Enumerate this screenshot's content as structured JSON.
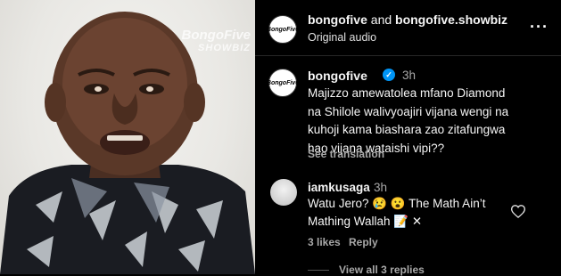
{
  "media": {
    "watermark_top": "BongoFive",
    "watermark_bottom": "SHOWBIZ"
  },
  "header": {
    "account_1": "bongofive",
    "and_text": " and ",
    "account_2": "bongofive.showbiz",
    "subtitle": "Original audio",
    "more_icon": "more-dots-icon",
    "logo_text": "BongoFive"
  },
  "caption": {
    "username": "bongofive",
    "time": "3h",
    "text": "Majizzo amewatolea mfano Diamond\nna Shilole walivyoajiri vijana wengi na\nkuhoji kama biashara zao zitafungwa\nhao vijana wataishi vipi??",
    "see_translation": "See translation",
    "logo_text": "BongoFive"
  },
  "reply": {
    "username": "iamkusaga",
    "time": "3h",
    "text": "Watu Jero? 😢 😮  The Math Ain’t Mathing Wallah 📝 ✕",
    "likes": "3 likes",
    "reply_label": "Reply",
    "view_all": "View all 3 replies",
    "like_icon": "heart-outline-icon"
  },
  "colors": {
    "background": "#000000",
    "secondary_text": "#a8a8a8",
    "verified_blue": "#0095f6"
  }
}
